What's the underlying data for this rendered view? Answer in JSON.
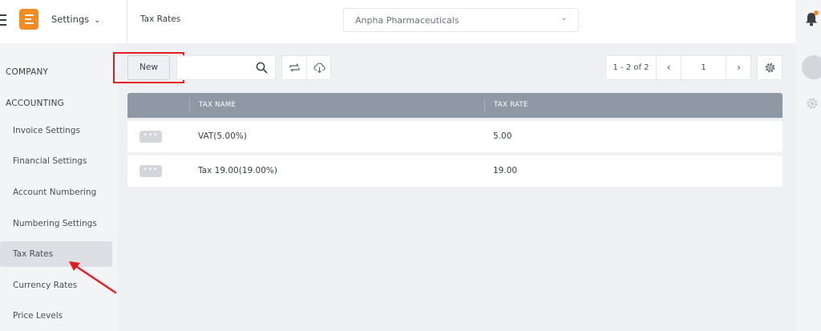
{
  "header": {
    "app_switch_label": "Settings",
    "page_title": "Tax Rates",
    "company": "Anpha Pharmaceuticals"
  },
  "sidebar": {
    "sections": [
      {
        "label": "COMPANY"
      },
      {
        "label": "ACCOUNTING"
      }
    ],
    "items": [
      {
        "label": "Invoice Settings"
      },
      {
        "label": "Financial Settings"
      },
      {
        "label": "Account Numbering"
      },
      {
        "label": "Numbering Settings"
      },
      {
        "label": "Tax Rates",
        "active": true
      },
      {
        "label": "Currency Rates"
      },
      {
        "label": "Price Levels"
      }
    ]
  },
  "toolbar": {
    "new_label": "New",
    "search_value": "",
    "icons": [
      "search-icon",
      "sync-icon",
      "cloud-download-icon",
      "gear-icon"
    ]
  },
  "pager": {
    "range": "1 - 2 of 2",
    "page": "1",
    "prev_glyph": "‹",
    "next_glyph": "›"
  },
  "table": {
    "columns": [
      "TAX NAME",
      "TAX RATE"
    ],
    "rows": [
      {
        "actions": "•••",
        "name": "VAT(5.00%)",
        "rate": "5.00"
      },
      {
        "actions": "•••",
        "name": "Tax 19.00(19.00%)",
        "rate": "19.00"
      }
    ]
  },
  "colors": {
    "accent": "#f28b22",
    "highlight": "#e41e1e",
    "table_header": "#8e99a5",
    "sidebar_active": "#dcdfe3"
  }
}
